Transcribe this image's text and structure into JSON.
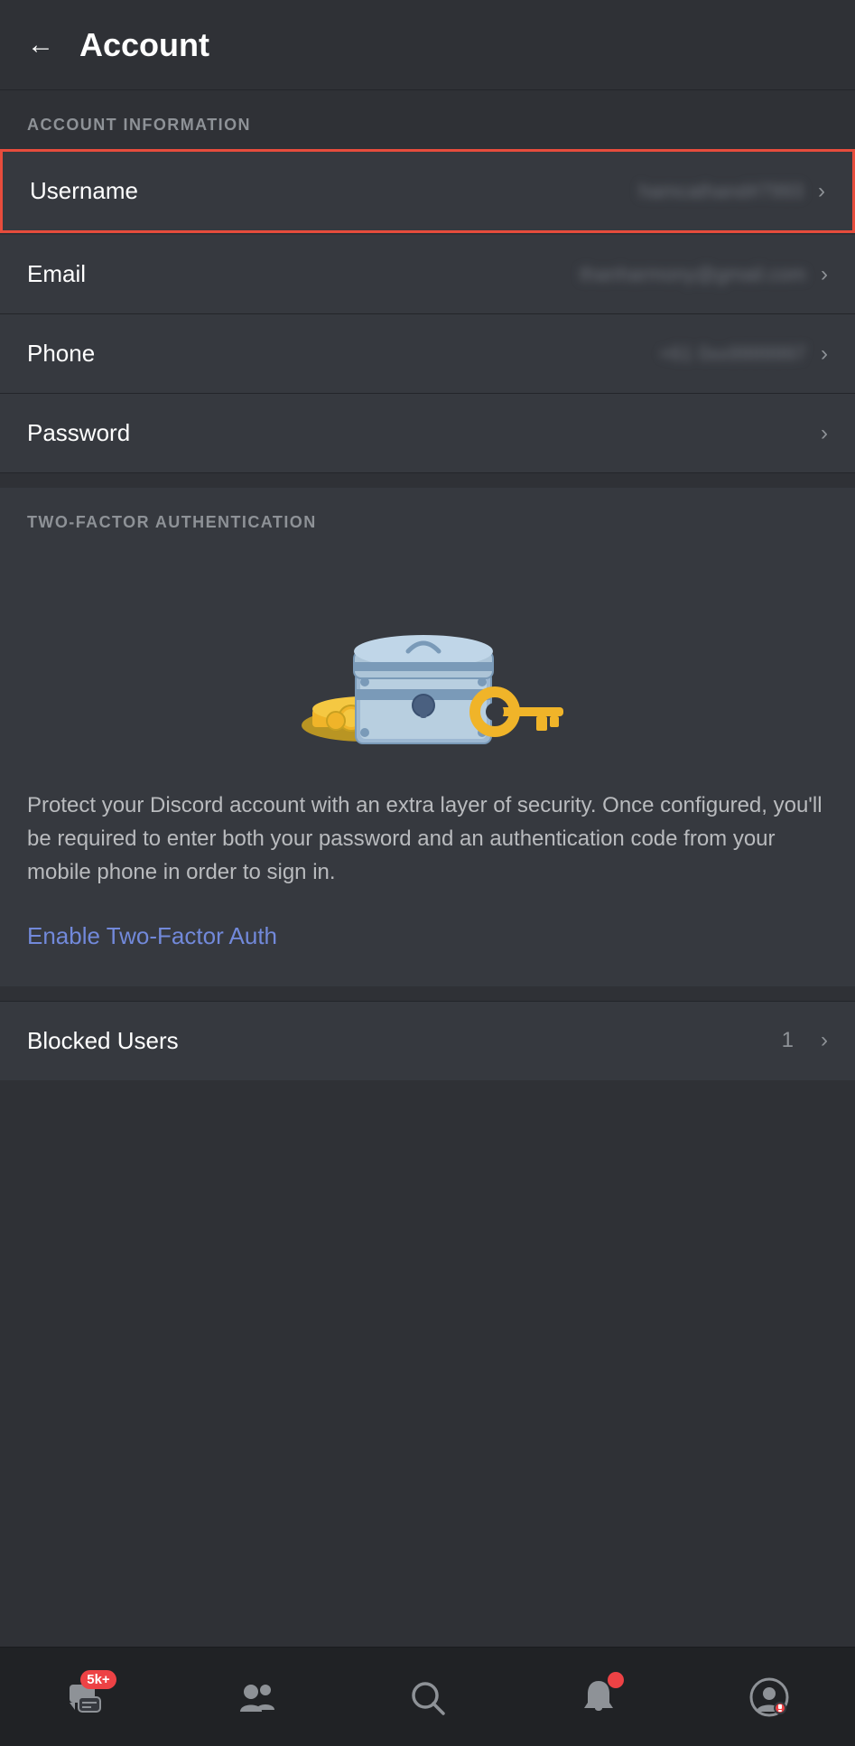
{
  "header": {
    "back_label": "←",
    "title": "Account"
  },
  "account_info": {
    "section_label": "ACCOUNT INFORMATION",
    "username": {
      "label": "Username",
      "value": "hamcathand#7993",
      "highlighted": true
    },
    "email": {
      "label": "Email",
      "value": "thanharmony@gmail.com"
    },
    "phone": {
      "label": "Phone",
      "value": "+61 0xx9999997"
    },
    "password": {
      "label": "Password",
      "value": ""
    }
  },
  "two_factor": {
    "section_label": "TWO-FACTOR AUTHENTICATION",
    "description": "Protect your Discord account with an extra layer of security. Once configured, you'll be required to enter both your password and an authentication code from your mobile phone in order to sign in.",
    "enable_link": "Enable Two-Factor Auth"
  },
  "blocked": {
    "label": "Blocked Users",
    "count": "1"
  },
  "nav": {
    "items": [
      {
        "name": "messages-icon",
        "badge": "5k+",
        "has_badge": true
      },
      {
        "name": "friends-icon",
        "badge": "",
        "has_badge": false
      },
      {
        "name": "search-icon",
        "badge": "",
        "has_badge": false
      },
      {
        "name": "notifications-icon",
        "badge": "●",
        "has_badge": true,
        "badge_dot": true
      },
      {
        "name": "profile-icon",
        "badge": "",
        "has_badge": false
      }
    ]
  }
}
